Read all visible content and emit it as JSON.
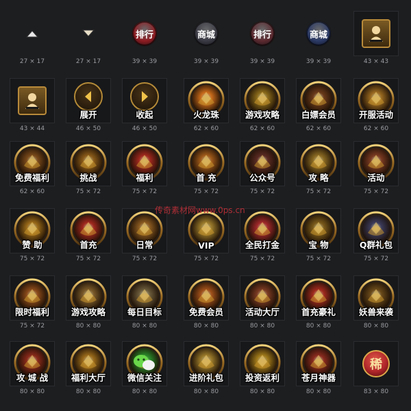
{
  "watermark": "传奇素材网www.0ps.cn",
  "colors": {
    "gold": "#c9962d",
    "gold_light": "#f0cc6a",
    "ring_dark": "#3a2c18",
    "label_white": "#ffffff",
    "dim_text": "#9a9ca0",
    "rank_red": "#8e1c22",
    "city_blue": "#2b3a66",
    "badge_red": "#b0262a"
  },
  "rows": [
    [
      {
        "kind": "arrow-up",
        "icon": "arrow-up-icon",
        "dim": "27 × 17"
      },
      {
        "kind": "arrow-down",
        "icon": "arrow-down-icon",
        "dim": "27 × 17"
      },
      {
        "kind": "orb",
        "icon": "ranking-icon",
        "label": "排行",
        "orb_color": "#8e1c22",
        "dim": "39 × 39"
      },
      {
        "kind": "orb",
        "icon": "city-icon",
        "label": "商城",
        "orb_color": "#3a3a44",
        "dim": "39 × 39"
      },
      {
        "kind": "orb",
        "icon": "ranking-icon",
        "label": "排行",
        "orb_color": "#5c2a30",
        "dim": "39 × 39"
      },
      {
        "kind": "orb",
        "icon": "city-icon",
        "label": "商城",
        "orb_color": "#2b3a66",
        "dim": "39 × 39"
      },
      {
        "kind": "avatar",
        "icon": "avatar-icon",
        "dim": "43 × 43"
      }
    ],
    [
      {
        "kind": "avatar",
        "icon": "avatar-icon",
        "dim": "43 × 44"
      },
      {
        "kind": "round",
        "icon": "chevron-left-icon",
        "label": "展开",
        "dim": "46 × 50"
      },
      {
        "kind": "round",
        "icon": "chevron-right-icon",
        "label": "收起",
        "dim": "46 × 50"
      },
      {
        "kind": "medal",
        "icon": "fire-dragon-orb-icon",
        "label": "火龙珠",
        "core": "#c96a1a",
        "dim": "62 × 60"
      },
      {
        "kind": "medal",
        "icon": "strategy-book-icon",
        "label": "游戏攻略",
        "core": "#8a6a1a",
        "dim": "62 × 60"
      },
      {
        "kind": "medal",
        "icon": "treasure-chest-icon",
        "label": "白嫖会员",
        "core": "#6a3a1a",
        "dim": "62 × 60"
      },
      {
        "kind": "medal",
        "icon": "server-open-icon",
        "label": "开服活动",
        "core": "#9a6a20",
        "dim": "62 × 60"
      }
    ],
    [
      {
        "kind": "medal",
        "icon": "free-welfare-icon",
        "label": "免费福利",
        "core": "#7a4a1a",
        "dim": "62 × 60"
      },
      {
        "kind": "medal",
        "icon": "challenge-icon",
        "label": "挑战",
        "core": "#8a5a18",
        "dim": "75 × 72"
      },
      {
        "kind": "medal",
        "icon": "gift-box-icon",
        "label": "福利",
        "core": "#a0281e",
        "dim": "75 × 72"
      },
      {
        "kind": "medal",
        "icon": "first-recharge-chest-icon",
        "label": "首 充",
        "core": "#a05a1a",
        "dim": "75 × 72"
      },
      {
        "kind": "medal",
        "icon": "portrait-icon",
        "label": "公众号",
        "core": "#5a2a22",
        "dim": "75 × 72"
      },
      {
        "kind": "medal",
        "icon": "scroll-icon",
        "label": "攻 略",
        "core": "#8a6a22",
        "dim": "75 × 72"
      },
      {
        "kind": "medal",
        "icon": "drum-icon",
        "label": "活动",
        "core": "#7a3a22",
        "dim": "75 × 72"
      }
    ],
    [
      {
        "kind": "medal",
        "icon": "sponsor-coin-icon",
        "label": "赞 助",
        "core": "#9a6a18",
        "dim": "75 × 72"
      },
      {
        "kind": "medal",
        "icon": "gift-box-icon",
        "label": "首充",
        "core": "#a0281e",
        "dim": "75 × 72"
      },
      {
        "kind": "medal",
        "icon": "horn-icon",
        "label": "日常",
        "core": "#8a5a20",
        "dim": "75 × 72"
      },
      {
        "kind": "medal",
        "icon": "vip-icon",
        "label": "VIP",
        "core": "#9a7a2a",
        "dim": "75 × 72"
      },
      {
        "kind": "medal",
        "icon": "gold-flag-icon",
        "label": "全民打金",
        "core": "#a0282a",
        "dim": "75 × 72"
      },
      {
        "kind": "medal",
        "icon": "crest-icon",
        "label": "宝 物",
        "core": "#7a5a1a",
        "dim": "75 × 72"
      },
      {
        "kind": "medal",
        "icon": "penguin-icon",
        "label": "Q群礼包",
        "core": "#3a3a5a",
        "dim": "75 × 72"
      }
    ],
    [
      {
        "kind": "medal",
        "icon": "limited-welfare-icon",
        "label": "限时福利",
        "core": "#8a4a1a",
        "dim": "75 × 72"
      },
      {
        "kind": "medal",
        "icon": "strategy-book-icon",
        "label": "游戏攻略",
        "core": "#7a5a2a",
        "dim": "80 × 80"
      },
      {
        "kind": "medal",
        "icon": "daily-goal-icon",
        "label": "每日目标",
        "core": "#6a5a3a",
        "dim": "80 × 80"
      },
      {
        "kind": "medal",
        "icon": "free-member-icon",
        "label": "免费会员",
        "core": "#a0501a",
        "dim": "80 × 80"
      },
      {
        "kind": "medal",
        "icon": "activity-hall-icon",
        "label": "活动大厅",
        "core": "#7a3a22",
        "dim": "80 × 80"
      },
      {
        "kind": "medal",
        "icon": "recharge-gift-icon",
        "label": "首充豪礼",
        "core": "#a02a1e",
        "dim": "80 × 80"
      },
      {
        "kind": "medal",
        "icon": "monster-raid-icon",
        "label": "妖兽来袭",
        "core": "#6a4a1a",
        "dim": "80 × 80"
      }
    ],
    [
      {
        "kind": "medal",
        "icon": "siege-icon",
        "label": "攻 城 战",
        "core": "#8a2a1a",
        "dim": "80 × 80"
      },
      {
        "kind": "medal",
        "icon": "welfare-hall-icon",
        "label": "福利大厅",
        "core": "#9a6a1a",
        "dim": "80 × 80"
      },
      {
        "kind": "medal",
        "icon": "wechat-icon",
        "label": "微信关注",
        "core": "#2a8a2a",
        "dim": "80 × 80"
      },
      {
        "kind": "medal",
        "icon": "advance-gift-icon",
        "label": "进阶礼包",
        "core": "#9a7a2a",
        "dim": "80 × 80"
      },
      {
        "kind": "medal",
        "icon": "coin-icon",
        "label": "投资返利",
        "core": "#a07a1a",
        "dim": "80 × 80"
      },
      {
        "kind": "medal",
        "icon": "moon-weapon-icon",
        "label": "苍月神器",
        "core": "#8a2a1e",
        "dim": "80 × 80"
      },
      {
        "kind": "badge",
        "icon": "red-badge-icon",
        "label": "稀",
        "dim": "83 × 80"
      }
    ]
  ]
}
